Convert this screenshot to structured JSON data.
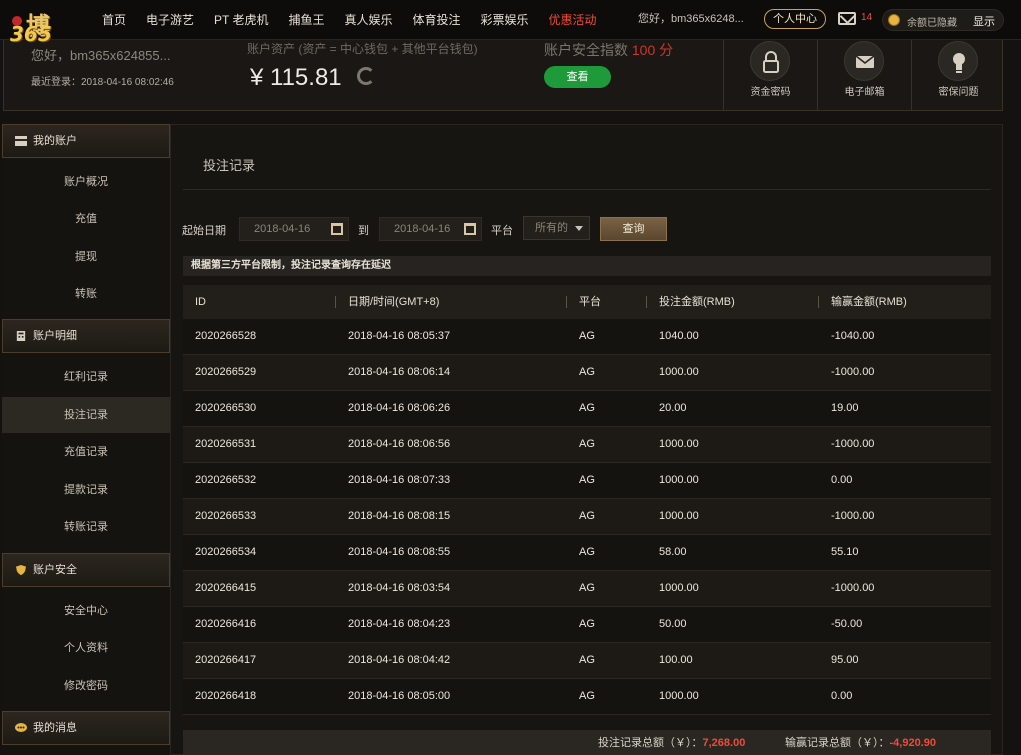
{
  "logo": {
    "line1": "博",
    "line2": "365"
  },
  "nav": {
    "items": [
      "首页",
      "电子游艺",
      "PT 老虎机",
      "捕鱼王",
      "真人娱乐",
      "体育投注",
      "彩票娱乐",
      "优惠活动"
    ],
    "active_index": 7,
    "greeting": "您好，bm365x6248...",
    "user_center": "个人中心",
    "mail_count": "14",
    "balance_hidden": "余额已隐藏",
    "show": "显示"
  },
  "account": {
    "hello": "您好，bm365x624855...",
    "last_login": "最近登录：2018-04-16 08:02:46",
    "asset_label": "账户资产 (资产 = 中心钱包 + 其他平台钱包)",
    "asset_value": "¥ 115.81",
    "security_label": "账户安全指数",
    "security_score": "100 分",
    "view_button": "查看",
    "tiles": [
      "资金密码",
      "电子邮箱",
      "密保问题"
    ]
  },
  "sidebar": {
    "groups": [
      {
        "title": "我的账户",
        "items": [
          "账户概况",
          "充值",
          "提现",
          "转账"
        ]
      },
      {
        "title": "账户明细",
        "items": [
          "红利记录",
          "投注记录",
          "充值记录",
          "提款记录",
          "转账记录"
        ]
      },
      {
        "title": "账户安全",
        "items": [
          "安全中心",
          "个人资料",
          "修改密码"
        ]
      },
      {
        "title": "我的消息",
        "items": []
      }
    ],
    "selected": "投注记录"
  },
  "main": {
    "title": "投注记录",
    "filter": {
      "start_label": "起始日期",
      "start_value": "2018-04-16",
      "to_label": "到",
      "end_value": "2018-04-16",
      "platform_label": "平台",
      "platform_value": "所有的",
      "query_button": "查询"
    },
    "notice": "根据第三方平台限制，投注记录查询存在延迟",
    "table": {
      "columns": [
        "ID",
        "日期/时间(GMT+8)",
        "平台",
        "投注金额(RMB)",
        "输赢金额(RMB)"
      ],
      "rows": [
        [
          "2020266528",
          "2018-04-16 08:05:37",
          "AG",
          "1040.00",
          "-1040.00"
        ],
        [
          "2020266529",
          "2018-04-16 08:06:14",
          "AG",
          "1000.00",
          "-1000.00"
        ],
        [
          "2020266530",
          "2018-04-16 08:06:26",
          "AG",
          "20.00",
          "19.00"
        ],
        [
          "2020266531",
          "2018-04-16 08:06:56",
          "AG",
          "1000.00",
          "-1000.00"
        ],
        [
          "2020266532",
          "2018-04-16 08:07:33",
          "AG",
          "1000.00",
          "0.00"
        ],
        [
          "2020266533",
          "2018-04-16 08:08:15",
          "AG",
          "1000.00",
          "-1000.00"
        ],
        [
          "2020266534",
          "2018-04-16 08:08:55",
          "AG",
          "58.00",
          "55.10"
        ],
        [
          "2020266415",
          "2018-04-16 08:03:54",
          "AG",
          "1000.00",
          "-1000.00"
        ],
        [
          "2020266416",
          "2018-04-16 08:04:23",
          "AG",
          "50.00",
          "-50.00"
        ],
        [
          "2020266417",
          "2018-04-16 08:04:42",
          "AG",
          "100.00",
          "95.00"
        ],
        [
          "2020266418",
          "2018-04-16 08:05:00",
          "AG",
          "1000.00",
          "0.00"
        ]
      ]
    },
    "totals": {
      "bet_label": "投注记录总额（￥）：",
      "bet_value": "7,268.00",
      "win_label": "输赢记录总额（￥）：",
      "win_value": "-4,920.90"
    }
  },
  "colors": {
    "accent": "#ef4b3a",
    "green": "#1e9a3a",
    "gold": "#c9a45a"
  }
}
